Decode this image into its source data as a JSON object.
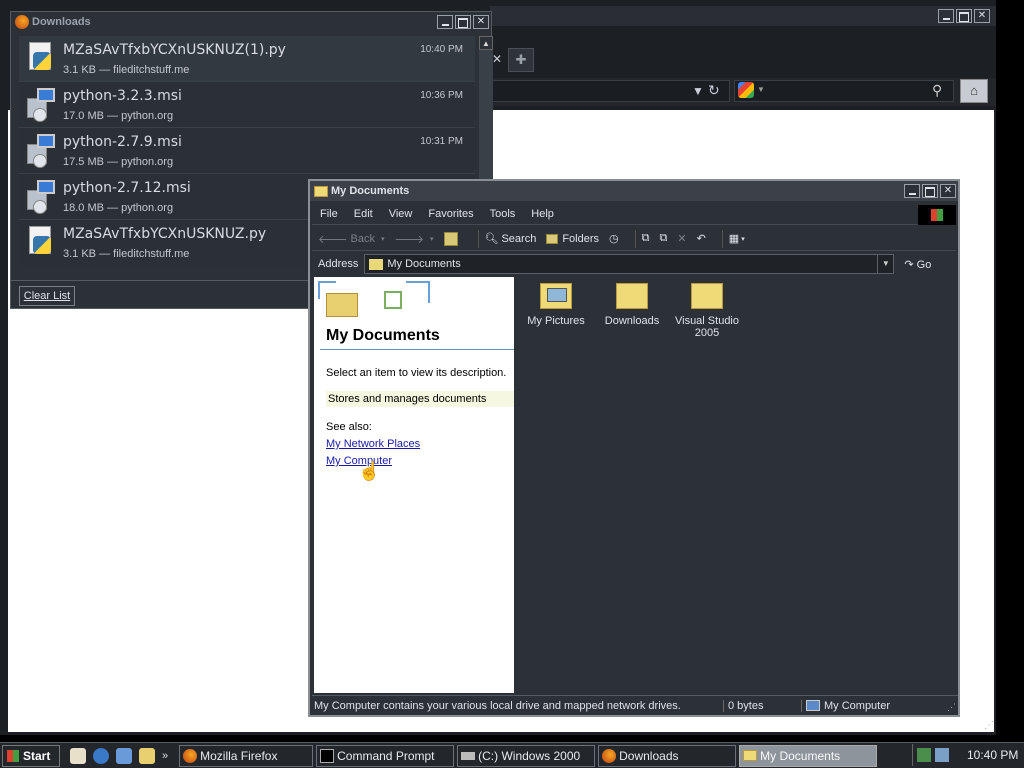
{
  "colors": {
    "window_bg": "#2c3138",
    "link": "#1a1aa8",
    "active_task": "#8d949c"
  },
  "downloads": {
    "title": "Downloads",
    "items": [
      {
        "name": "MZaSAvTfxbYCXnUSKNUZ(1).py",
        "info": "3.1 KB — fileditchstuff.me",
        "time": "10:40 PM",
        "icon": "python-file-icon"
      },
      {
        "name": "python-3.2.3.msi",
        "info": "17.0 MB — python.org",
        "time": "10:36 PM",
        "icon": "msi-installer-icon"
      },
      {
        "name": "python-2.7.9.msi",
        "info": "17.5 MB — python.org",
        "time": "10:31 PM",
        "icon": "msi-installer-icon"
      },
      {
        "name": "python-2.7.12.msi",
        "info": "18.0 MB — python.org",
        "time": "",
        "icon": "msi-installer-icon"
      },
      {
        "name": "MZaSAvTfxbYCXnUSKNUZ.py",
        "info": "3.1 KB — fileditchstuff.me",
        "time": "",
        "icon": "python-file-icon"
      }
    ],
    "clear_label": "Clear List"
  },
  "explorer": {
    "title": "My Documents",
    "menu": [
      "File",
      "Edit",
      "View",
      "Favorites",
      "Tools",
      "Help"
    ],
    "toolbar": {
      "back": "Back",
      "search": "Search",
      "folders": "Folders"
    },
    "address_label": "Address",
    "address_value": "My Documents",
    "go_label": "Go",
    "left_panel": {
      "heading": "My Documents",
      "select_text": "Select an item to view its description.",
      "description": "Stores and manages documents",
      "see_also": "See also:",
      "links": [
        "My Network Places",
        "My Computer"
      ]
    },
    "folders": [
      {
        "name": "My Pictures",
        "icon": "my-pictures-folder-icon"
      },
      {
        "name": "Downloads",
        "icon": "folder-icon"
      },
      {
        "name": "Visual Studio 2005",
        "icon": "folder-icon"
      }
    ],
    "status": {
      "message": "My Computer contains your various local drive and mapped network drives.",
      "size": "0 bytes",
      "zone": "My Computer"
    }
  },
  "taskbar": {
    "start_label": "Start",
    "tasks": [
      {
        "label": "Mozilla Firefox",
        "icon": "firefox-icon",
        "active": false
      },
      {
        "label": "Command Prompt",
        "icon": "cmd-icon",
        "active": false
      },
      {
        "label": "(C:) Windows 2000",
        "icon": "drive-icon",
        "active": false
      },
      {
        "label": "Downloads",
        "icon": "firefox-icon",
        "active": false
      },
      {
        "label": "My Documents",
        "icon": "folder-icon",
        "active": true
      }
    ],
    "clock": "10:40 PM"
  }
}
